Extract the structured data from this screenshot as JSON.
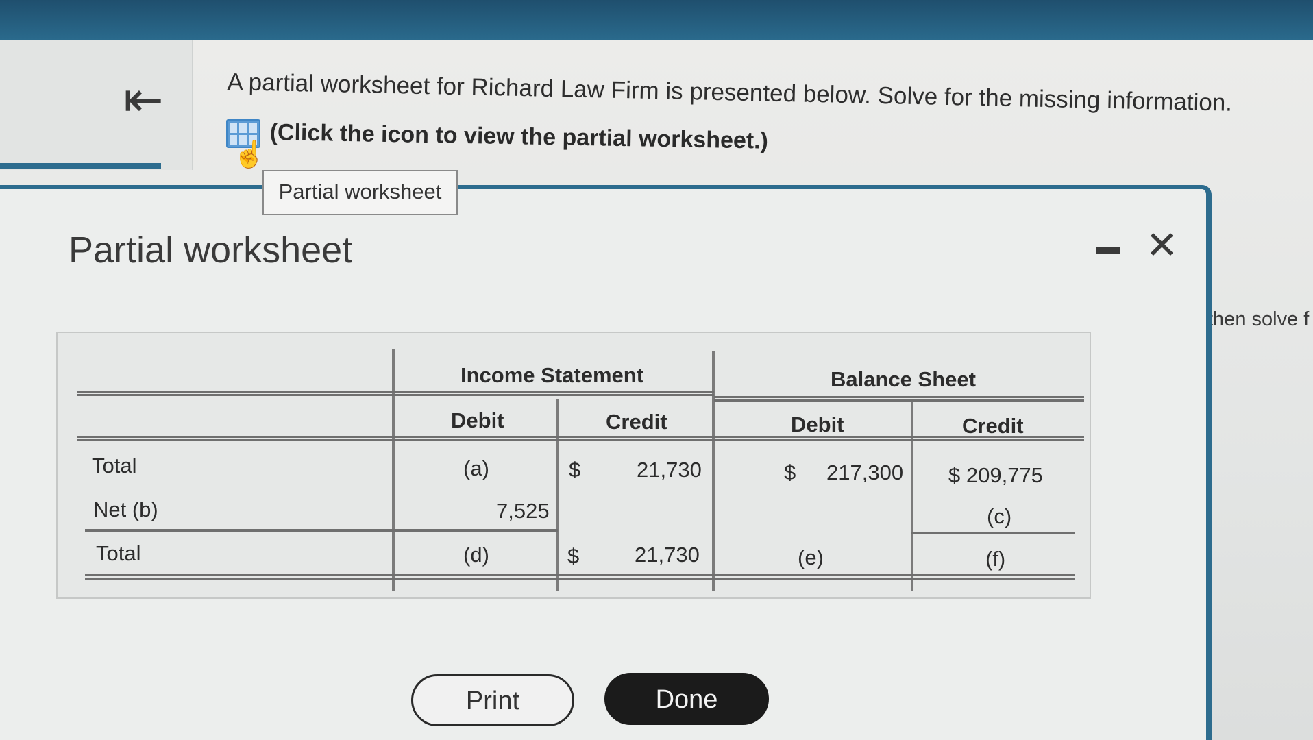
{
  "question": {
    "text": "A partial worksheet for Richard Law Firm is presented below. Solve for the missing information.",
    "click_text": "(Click the icon to view the partial worksheet.)"
  },
  "tab": {
    "label": "Partial worksheet"
  },
  "modal": {
    "title": "Partial worksheet",
    "side_text": "then solve f"
  },
  "worksheet": {
    "income_statement": "Income Statement",
    "balance_sheet": "Balance Sheet",
    "debit": "Debit",
    "credit": "Credit",
    "rows": [
      {
        "label": "Total",
        "is_debit": "(a)",
        "is_credit_sym": "$",
        "is_credit": "21,730",
        "bs_debit_sym": "$",
        "bs_debit": "217,300",
        "bs_credit": "$  209,775"
      },
      {
        "label": "Net (b)",
        "is_debit": "7,525",
        "bs_credit": "(c)"
      },
      {
        "label": "Total",
        "is_debit": "(d)",
        "is_credit_sym": "$",
        "is_credit": "21,730",
        "bs_debit": "(e)",
        "bs_credit": "(f)"
      }
    ]
  },
  "buttons": {
    "print": "Print",
    "done": "Done"
  }
}
